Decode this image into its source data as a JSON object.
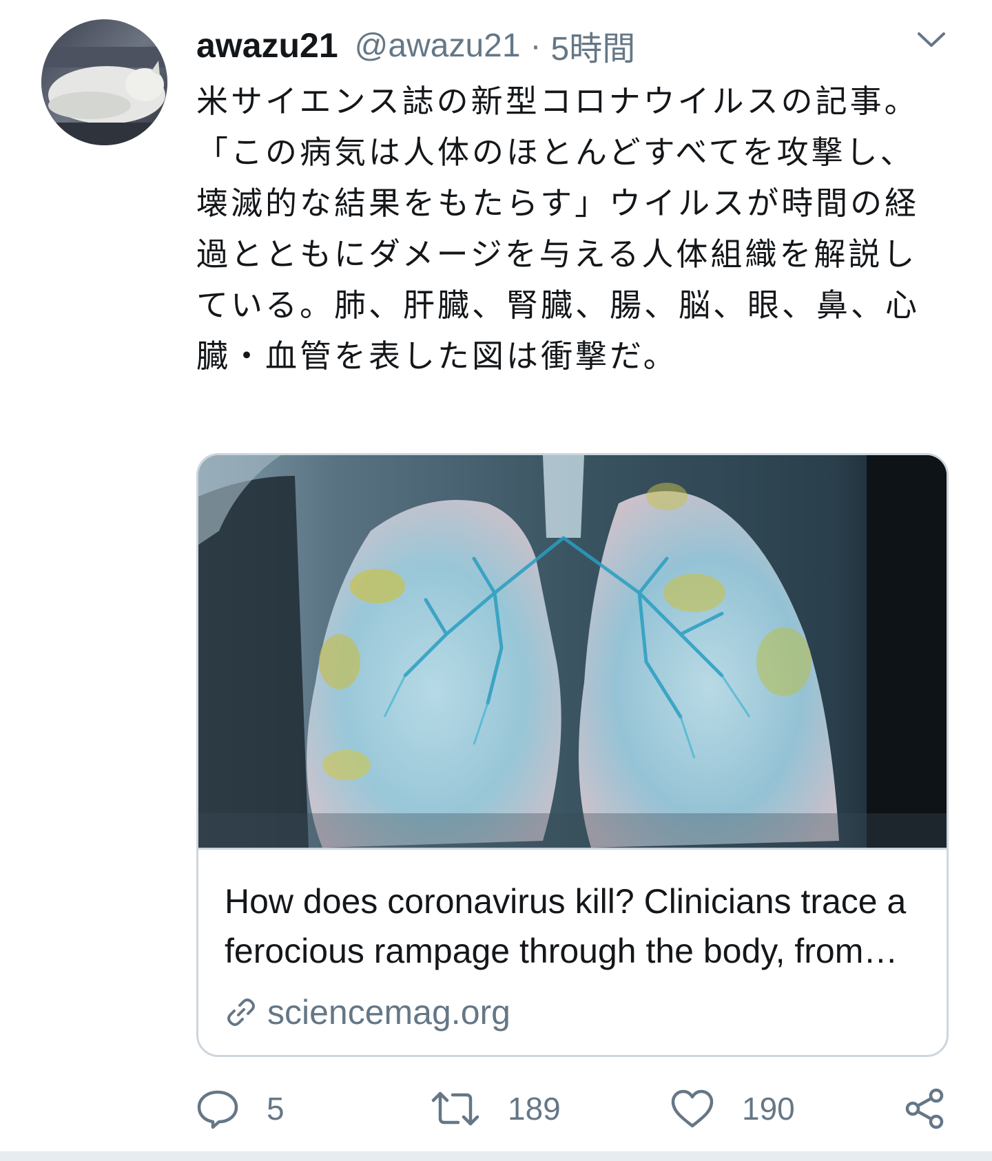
{
  "tweet": {
    "display_name": "awazu21",
    "username": "@awazu21",
    "separator": "·",
    "timestamp": "5時間",
    "text": "米サイエンス誌の新型コロナウイルスの記事。「この病気は人体のほとんどすべてを攻撃し、壊滅的な結果をもたらす」ウイルスが時間の経過とともにダメージを与える人体組織を解説している。肺、肝臓、腎臓、腸、脳、眼、鼻、心臓・血管を表した図は衝撃だ。",
    "menu_icon": "chevron-down-icon"
  },
  "card": {
    "image_icon": "lungs-scan-image",
    "title": "How does coronavirus kill? Clinicians trace a ferocious rampage through the body, from brain to toes",
    "domain": "sciencemag.org",
    "domain_icon": "link-icon"
  },
  "actions": {
    "reply": {
      "icon": "reply-icon",
      "count": "5"
    },
    "retweet": {
      "icon": "retweet-icon",
      "count": "189"
    },
    "like": {
      "icon": "heart-icon",
      "count": "190"
    },
    "share": {
      "icon": "share-icon"
    }
  },
  "colors": {
    "text_primary": "#14171a",
    "text_secondary": "#657786",
    "border": "#ccd6dd"
  }
}
